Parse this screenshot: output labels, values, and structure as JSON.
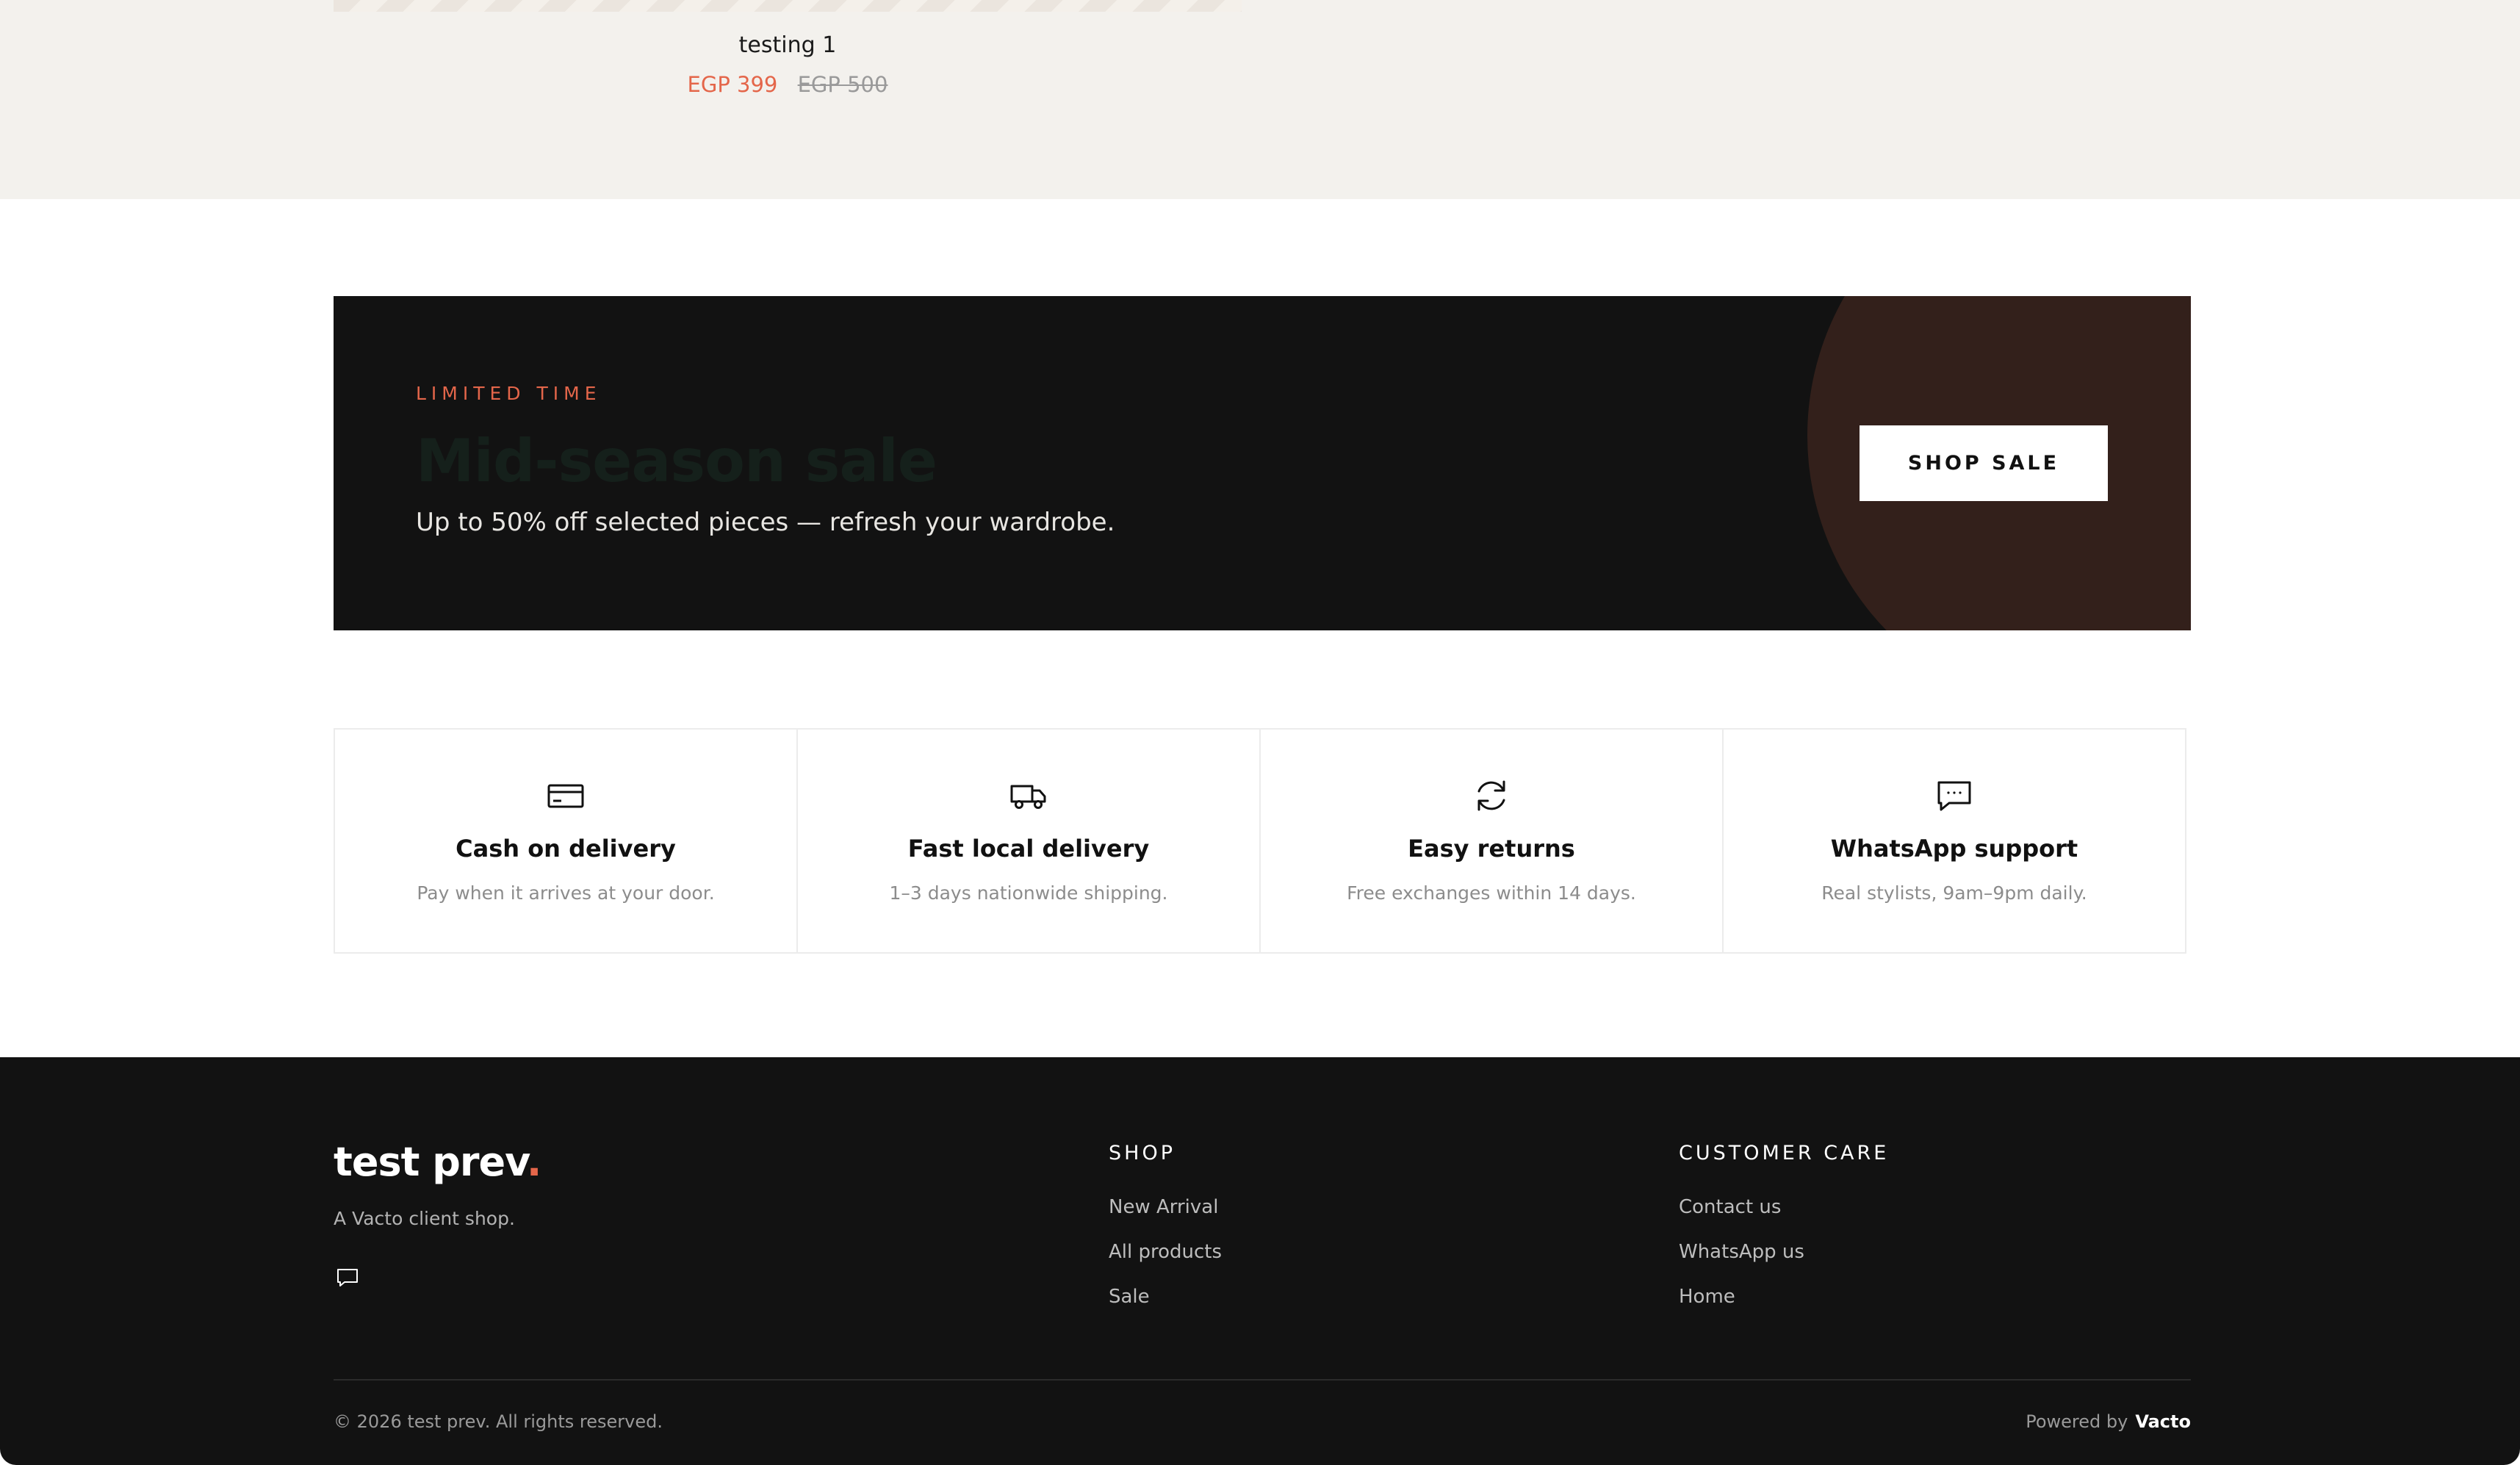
{
  "product": {
    "name": "testing 1",
    "price": "EGP 399",
    "compare_price": "EGP 500"
  },
  "promo": {
    "eyebrow": "LIMITED TIME",
    "title": "Mid-season sale",
    "subtitle": "Up to 50% off selected pieces — refresh your wardrobe.",
    "button_label": "SHOP SALE",
    "colors": {
      "background": "#121212",
      "accent_circle": "#33201b",
      "eyebrow": "#e4664a"
    }
  },
  "features": [
    {
      "icon": "credit-card-icon",
      "title": "Cash on delivery",
      "description": "Pay when it arrives at your door."
    },
    {
      "icon": "truck-icon",
      "title": "Fast local delivery",
      "description": "1–3 days nationwide shipping."
    },
    {
      "icon": "refresh-icon",
      "title": "Easy returns",
      "description": "Free exchanges within 14 days."
    },
    {
      "icon": "chat-icon",
      "title": "WhatsApp support",
      "description": "Real stylists, 9am–9pm daily."
    }
  ],
  "footer": {
    "brand_name": "test prev",
    "brand_dot": ".",
    "tagline": "A Vacto client shop.",
    "social_icon": "chat-icon",
    "shop": {
      "heading": "SHOP",
      "links": [
        "New Arrival",
        "All products",
        "Sale"
      ]
    },
    "customer_care": {
      "heading": "CUSTOMER CARE",
      "links": [
        "Contact us",
        "WhatsApp us",
        "Home"
      ]
    },
    "copyright": "© 2026 test prev. All rights reserved.",
    "powered_by_label": "Powered by",
    "powered_by_brand": "Vacto"
  },
  "colors": {
    "accent": "#e4664a",
    "dark": "#121212",
    "cream": "#f3f1ed"
  }
}
